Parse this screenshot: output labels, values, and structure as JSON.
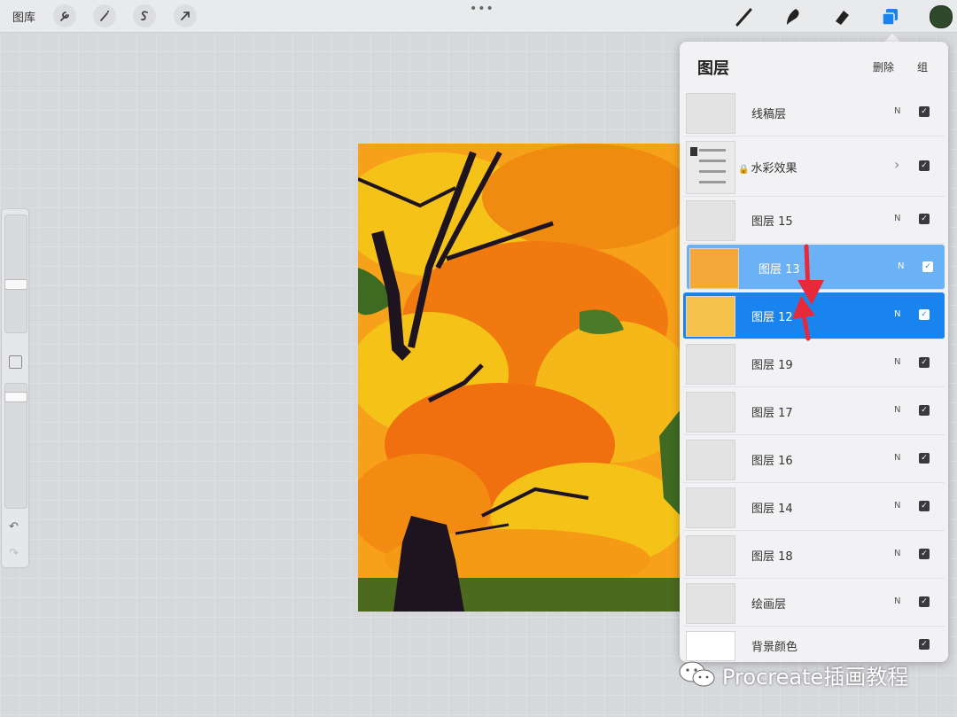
{
  "toolbar": {
    "gallery_label": "图库",
    "actions_icon": "wrench-icon",
    "adjustments_icon": "magic-wand-icon",
    "selection_icon": "selection-s-icon",
    "transform_icon": "arrow-cursor-icon",
    "handle": "•••",
    "right_tools": [
      "brush-icon",
      "smudge-icon",
      "eraser-icon",
      "layers-icon"
    ],
    "active_color": "#2e4a2a",
    "accent": "#1a84ee"
  },
  "sidebar": {
    "undo": "↶",
    "redo": "↷"
  },
  "layers": {
    "title": "图层",
    "delete_label": "删除",
    "group_label": "组",
    "items": [
      {
        "name": "线稿层",
        "blend": "N",
        "visible": true
      },
      {
        "name": "水彩效果",
        "locked": true,
        "group": true,
        "visible": true
      },
      {
        "name": "图层 15",
        "blend": "N",
        "visible": true
      },
      {
        "name": "图层 13",
        "blend": "N",
        "visible": true,
        "state": "dragging"
      },
      {
        "name": "图层 12",
        "blend": "N",
        "visible": true,
        "state": "selected"
      },
      {
        "name": "图层 19",
        "blend": "N",
        "visible": true
      },
      {
        "name": "图层 17",
        "blend": "N",
        "visible": true
      },
      {
        "name": "图层 16",
        "blend": "N",
        "visible": true
      },
      {
        "name": "图层 14",
        "blend": "N",
        "visible": true
      },
      {
        "name": "图层 18",
        "blend": "N",
        "visible": true
      },
      {
        "name": "绘画层",
        "blend": "N",
        "visible": true
      },
      {
        "name": "背景颜色",
        "visible": true
      }
    ]
  },
  "watermark": {
    "icon": "wechat-icon",
    "text": "Procreate插画教程"
  }
}
